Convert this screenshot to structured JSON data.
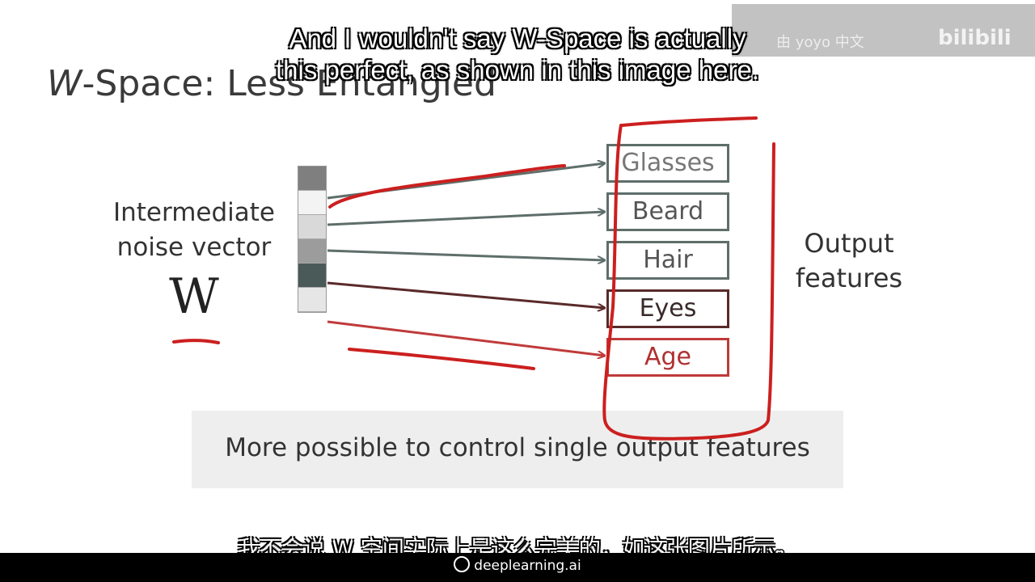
{
  "slide": {
    "title_w": "W",
    "title_rest": "-Space: Less Entangled",
    "intermediate_label_line1": "Intermediate",
    "intermediate_label_line2": "noise vector",
    "w_symbol": "W",
    "output_label_line1": "Output",
    "output_label_line2": "features",
    "caption": "More possible to control single output features",
    "vector_cells": [
      "#7f7f7f",
      "#f3f3f3",
      "#d9d9d9",
      "#9c9c9c",
      "#4a5a58",
      "#e6e6e6"
    ],
    "features": [
      {
        "label": "Glasses",
        "color": "#777777",
        "border": "#5e6e6b"
      },
      {
        "label": "Beard",
        "color": "#555555",
        "border": "#5e6e6b"
      },
      {
        "label": "Hair",
        "color": "#555555",
        "border": "#5e6e6b"
      },
      {
        "label": "Eyes",
        "color": "#3a2a2a",
        "border": "#5a2a2a"
      },
      {
        "label": "Age",
        "color": "#b03030",
        "border": "#c03a3a"
      }
    ]
  },
  "subtitles": {
    "english_line1": "And I wouldn't say W-Space is actually",
    "english_line2": "this perfect, as shown in this image here.",
    "chinese": "我不会说 W 空间实际上是这么完美的，如这张图片所示。"
  },
  "watermark": {
    "text": "由 yoyo 中文",
    "logo": "bilibili"
  },
  "brand": {
    "name": "deeplearning.ai"
  },
  "colors": {
    "annotation_red": "#cc1f1f"
  }
}
